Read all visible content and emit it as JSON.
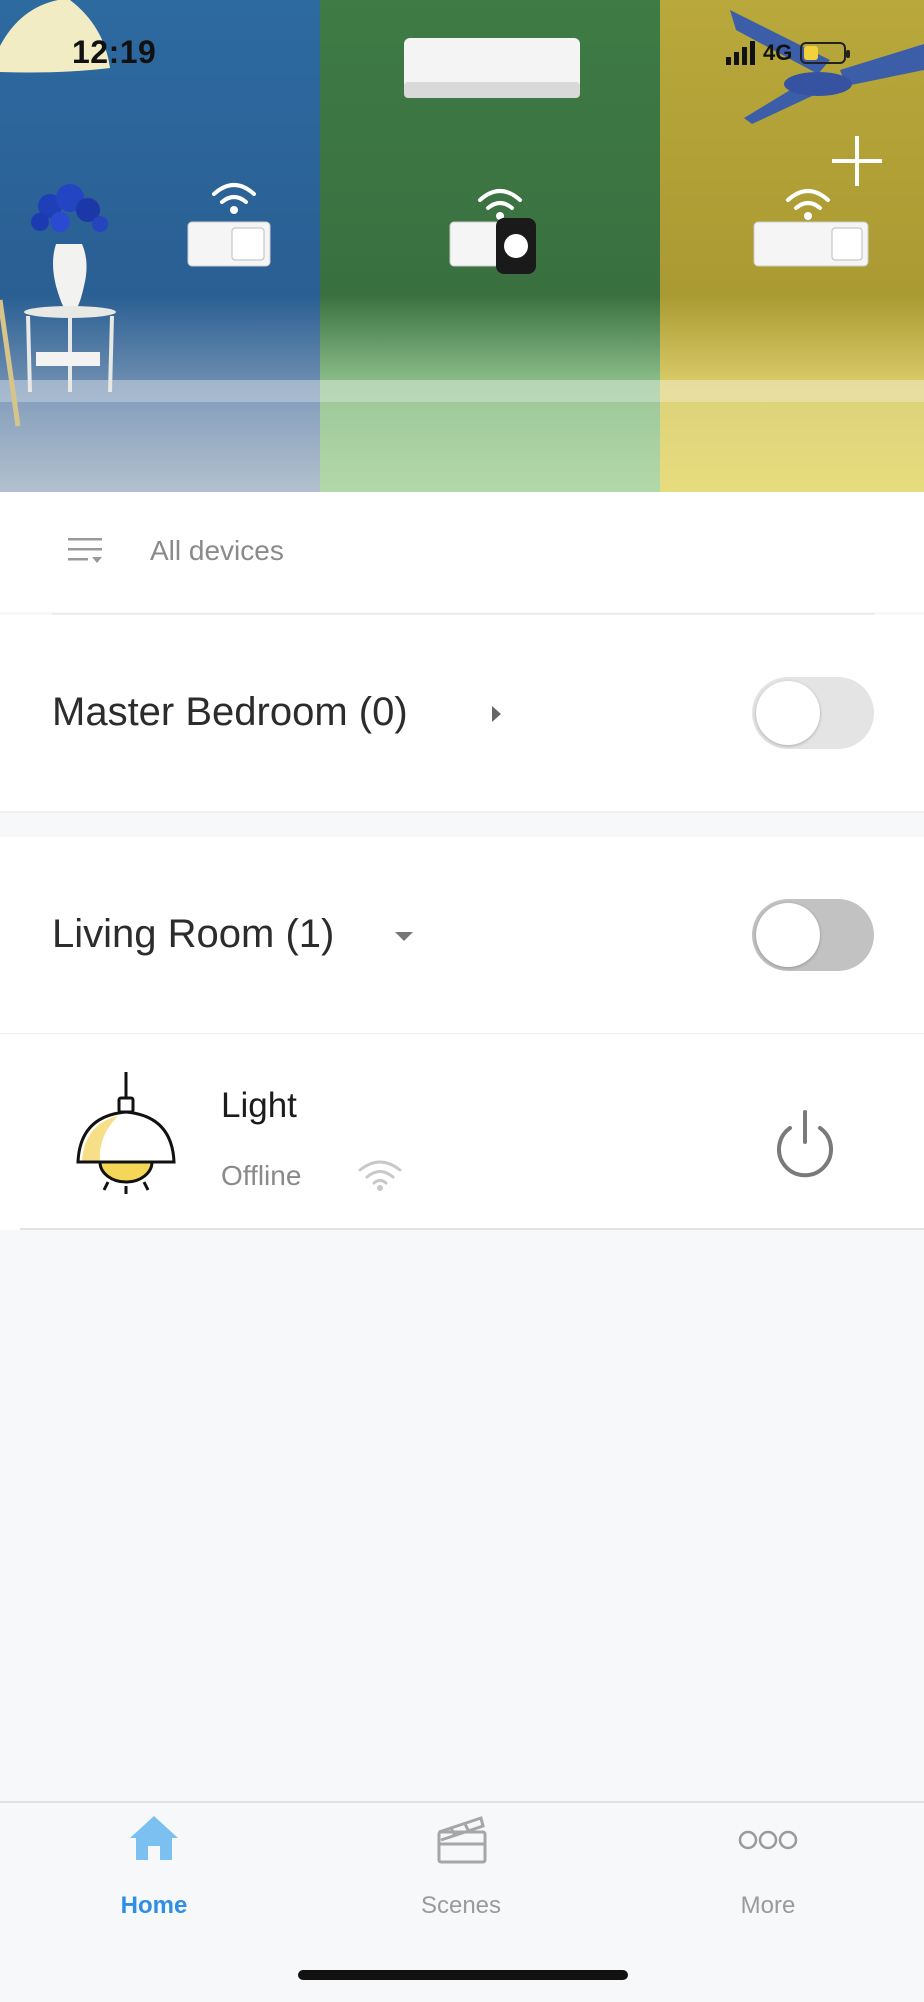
{
  "status_bar": {
    "time": "12:19",
    "network": "4G",
    "battery_color": "#f2d23c"
  },
  "header": {
    "add_icon": "plus-icon"
  },
  "filter": {
    "label": "All devices",
    "icon": "filter-list-icon"
  },
  "rooms": [
    {
      "title": "Master Bedroom (0)",
      "expanded": false,
      "toggle_on": false
    },
    {
      "title": "Living Room (1)",
      "expanded": true,
      "toggle_on": false
    }
  ],
  "devices": [
    {
      "name": "Light",
      "status": "Offline",
      "icon": "pendant-lamp-icon",
      "power_icon": "power-icon",
      "signal_icon": "wifi-icon"
    }
  ],
  "tabs": [
    {
      "label": "Home",
      "icon": "home-icon",
      "active": true
    },
    {
      "label": "Scenes",
      "icon": "clapperboard-icon",
      "active": false
    },
    {
      "label": "More",
      "icon": "more-dots-icon",
      "active": false
    }
  ],
  "colors": {
    "accent": "#2f8ee5",
    "inactive_tab": "#9a9a9a",
    "toggle_off": "#e4e4e4",
    "toggle_off_dark": "#c2c2c2"
  }
}
